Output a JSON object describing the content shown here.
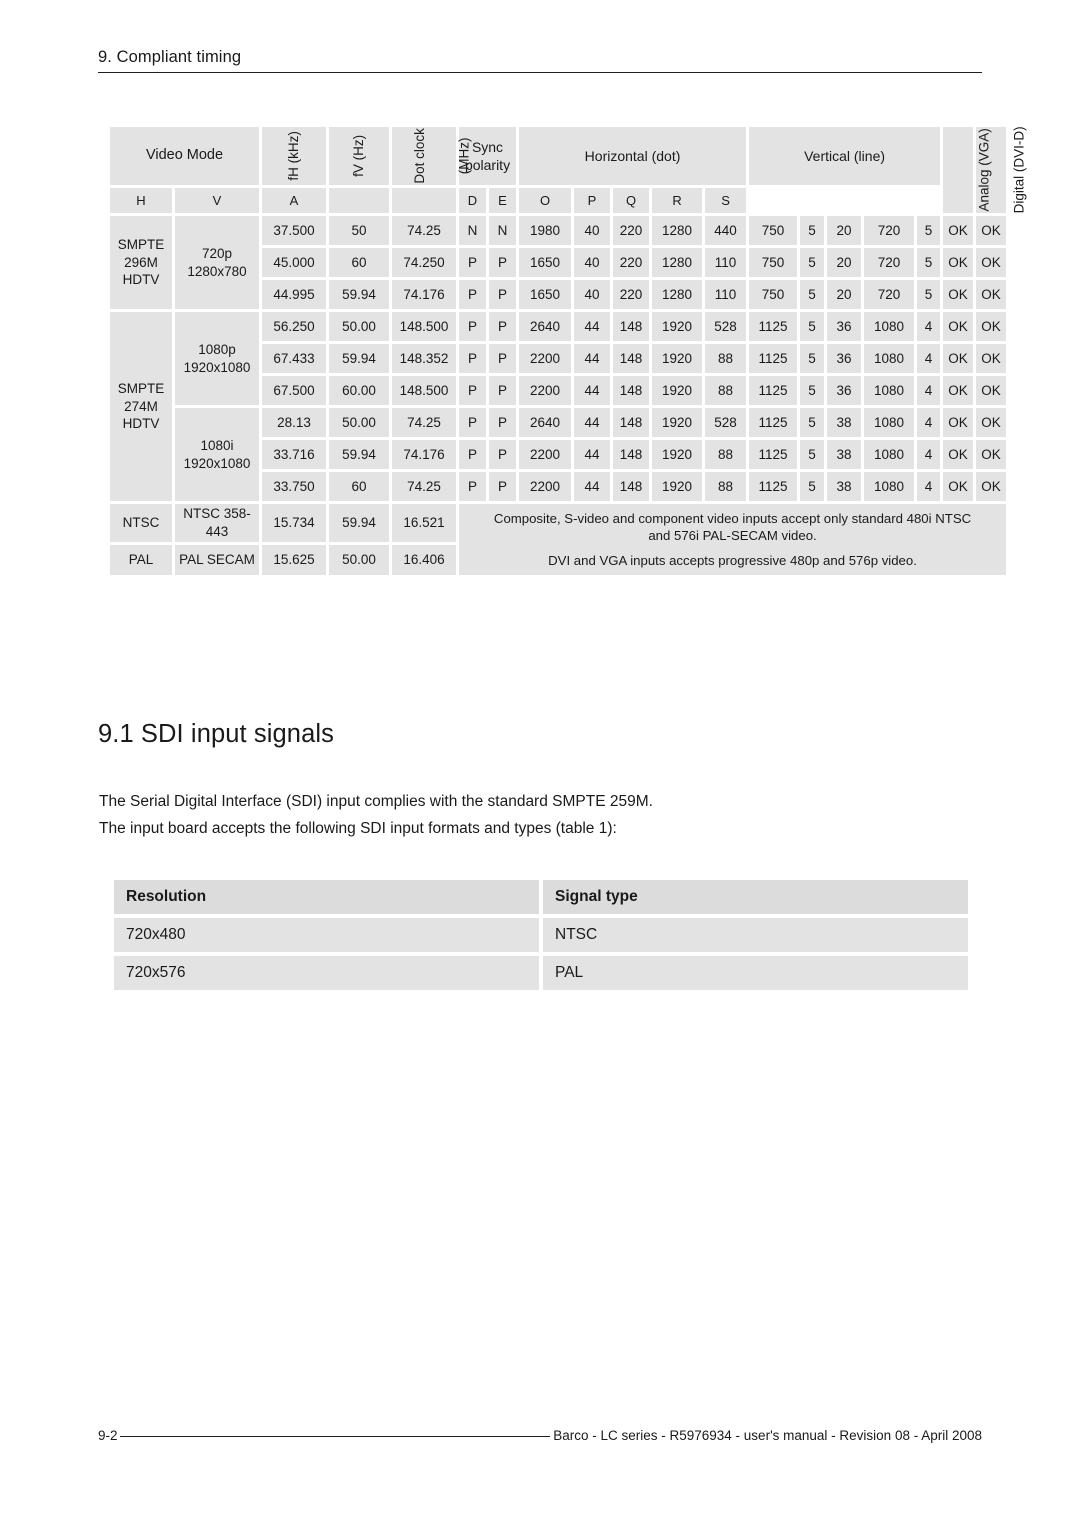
{
  "running_header": {
    "title": "9. Compliant timing"
  },
  "timing_table": {
    "headers": {
      "video_mode": "Video Mode",
      "fh": "fH (kHz)",
      "fv": "fV (Hz)",
      "dot_clock_line1": "Dot clock",
      "dot_clock_line2": "(MHz)",
      "sync_polarity_line1": "Sync",
      "sync_polarity_line2": "polarity",
      "horizontal": "Horizontal (dot)",
      "vertical": "Vertical (line)",
      "analog_vga": "Analog (VGA)",
      "digital_dvi": "Digital (DVI-D)",
      "sub": {
        "h": "H",
        "v": "V",
        "a": "A",
        "b": "",
        "c": "",
        "d": "D",
        "e": "E",
        "o": "O",
        "p": "P",
        "q": "Q",
        "r": "R",
        "s": "S"
      }
    },
    "groups": [
      {
        "standard_lines": [
          "SMPTE",
          "296M",
          "HDTV"
        ],
        "standard_rowspan": 3,
        "modes": [
          {
            "mode_lines": [
              "720p",
              "1280x780"
            ],
            "mode_rowspan": 3,
            "rows": [
              {
                "fh": "37.500",
                "fv": "50",
                "dot": "74.25",
                "h": "N",
                "v": "N",
                "a": "1980",
                "b": "40",
                "c": "220",
                "d": "1280",
                "e": "440",
                "o": "750",
                "p": "5",
                "q": "20",
                "r": "720",
                "s": "5",
                "vga": "OK",
                "dvi": "OK"
              },
              {
                "fh": "45.000",
                "fv": "60",
                "dot": "74.250",
                "h": "P",
                "v": "P",
                "a": "1650",
                "b": "40",
                "c": "220",
                "d": "1280",
                "e": "110",
                "o": "750",
                "p": "5",
                "q": "20",
                "r": "720",
                "s": "5",
                "vga": "OK",
                "dvi": "OK"
              },
              {
                "fh": "44.995",
                "fv": "59.94",
                "dot": "74.176",
                "h": "P",
                "v": "P",
                "a": "1650",
                "b": "40",
                "c": "220",
                "d": "1280",
                "e": "110",
                "o": "750",
                "p": "5",
                "q": "20",
                "r": "720",
                "s": "5",
                "vga": "OK",
                "dvi": "OK"
              }
            ]
          }
        ]
      },
      {
        "standard_lines": [
          "SMPTE",
          "274M",
          "HDTV"
        ],
        "standard_rowspan": 6,
        "modes": [
          {
            "mode_lines": [
              "1080p",
              "1920x1080"
            ],
            "mode_rowspan": 3,
            "rows": [
              {
                "fh": "56.250",
                "fv": "50.00",
                "dot": "148.500",
                "h": "P",
                "v": "P",
                "a": "2640",
                "b": "44",
                "c": "148",
                "d": "1920",
                "e": "528",
                "o": "1125",
                "p": "5",
                "q": "36",
                "r": "1080",
                "s": "4",
                "vga": "OK",
                "dvi": "OK"
              },
              {
                "fh": "67.433",
                "fv": "59.94",
                "dot": "148.352",
                "h": "P",
                "v": "P",
                "a": "2200",
                "b": "44",
                "c": "148",
                "d": "1920",
                "e": "88",
                "o": "1125",
                "p": "5",
                "q": "36",
                "r": "1080",
                "s": "4",
                "vga": "OK",
                "dvi": "OK"
              },
              {
                "fh": "67.500",
                "fv": "60.00",
                "dot": "148.500",
                "h": "P",
                "v": "P",
                "a": "2200",
                "b": "44",
                "c": "148",
                "d": "1920",
                "e": "88",
                "o": "1125",
                "p": "5",
                "q": "36",
                "r": "1080",
                "s": "4",
                "vga": "OK",
                "dvi": "OK"
              }
            ]
          },
          {
            "mode_lines": [
              "1080i",
              "1920x1080"
            ],
            "mode_rowspan": 3,
            "rows": [
              {
                "fh": "28.13",
                "fv": "50.00",
                "dot": "74.25",
                "h": "P",
                "v": "P",
                "a": "2640",
                "b": "44",
                "c": "148",
                "d": "1920",
                "e": "528",
                "o": "1125",
                "p": "5",
                "q": "38",
                "r": "1080",
                "s": "4",
                "vga": "OK",
                "dvi": "OK"
              },
              {
                "fh": "33.716",
                "fv": "59.94",
                "dot": "74.176",
                "h": "P",
                "v": "P",
                "a": "2200",
                "b": "44",
                "c": "148",
                "d": "1920",
                "e": "88",
                "o": "1125",
                "p": "5",
                "q": "38",
                "r": "1080",
                "s": "4",
                "vga": "OK",
                "dvi": "OK"
              },
              {
                "fh": "33.750",
                "fv": "60",
                "dot": "74.25",
                "h": "P",
                "v": "P",
                "a": "2200",
                "b": "44",
                "c": "148",
                "d": "1920",
                "e": "88",
                "o": "1125",
                "p": "5",
                "q": "38",
                "r": "1080",
                "s": "4",
                "vga": "OK",
                "dvi": "OK"
              }
            ]
          }
        ]
      }
    ],
    "analog_rows": [
      {
        "standard": "NTSC",
        "mode": "NTSC 358-443",
        "fh": "15.734",
        "fv": "59.94",
        "dot": "16.521"
      },
      {
        "standard": "PAL",
        "mode": "PAL SECAM",
        "fh": "15.625",
        "fv": "50.00",
        "dot": "16.406"
      }
    ],
    "analog_note": {
      "line1": "Composite, S-video and component video inputs accept only standard 480i NTSC",
      "line2": "and 576i PAL-SECAM video.",
      "line3": "DVI and VGA inputs accepts progressive 480p and 576p video."
    }
  },
  "section": {
    "heading": "9.1 SDI input signals",
    "paragraph_line1": "The Serial Digital Interface (SDI) input complies with the standard SMPTE 259M.",
    "paragraph_line2": "The input board accepts the following SDI input formats and types (table 1):"
  },
  "sdi_table": {
    "columns": [
      "Resolution",
      "Signal type"
    ],
    "rows": [
      [
        "720x480",
        "NTSC"
      ],
      [
        "720x576",
        "PAL"
      ]
    ]
  },
  "footer": {
    "page_number": "9-2",
    "text": "Barco - LC series - R5976934 - user's manual - Revision 08 - April 2008"
  },
  "colors": {
    "cell_fill": "#e3e3e3",
    "header_fill": "#dcdcdc",
    "rule": "#231f20",
    "text": "#1a1a1a"
  }
}
